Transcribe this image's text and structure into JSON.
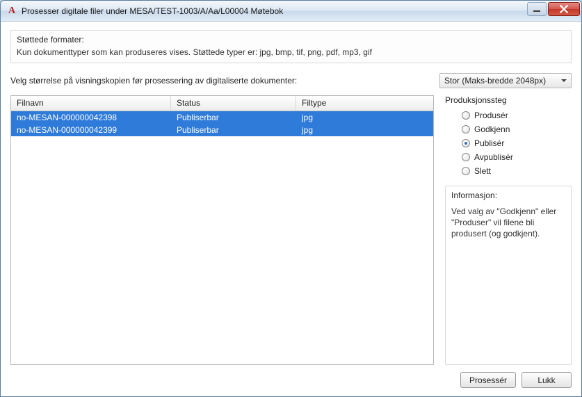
{
  "window": {
    "title": "Prosesser digitale filer under MESA/TEST-1003/A/Aa/L00004 Møtebok",
    "app_icon_glyph": "A"
  },
  "supported": {
    "title": "Støttede formater:",
    "body": "Kun dokumenttyper som kan produseres vises. Støttede typer er: jpg, bmp, tif, png, pdf, mp3, gif"
  },
  "size_row": {
    "label": "Velg størrelse på visningskopien før prosessering av digitaliserte dokumenter:",
    "selected": "Stor (Maks-bredde 2048px)"
  },
  "table": {
    "columns": {
      "filnavn": "Filnavn",
      "status": "Status",
      "filtype": "Filtype"
    },
    "rows": [
      {
        "filnavn": "no-MESAN-000000042398",
        "status": "Publiserbar",
        "filtype": "jpg",
        "selected": true
      },
      {
        "filnavn": "no-MESAN-000000042399",
        "status": "Publiserbar",
        "filtype": "jpg",
        "selected": true
      }
    ]
  },
  "steps": {
    "title": "Produksjonssteg",
    "options": [
      {
        "label": "Produsér",
        "checked": false
      },
      {
        "label": "Godkjenn",
        "checked": false
      },
      {
        "label": "Publisér",
        "checked": true
      },
      {
        "label": "Avpublisér",
        "checked": false
      },
      {
        "label": "Slett",
        "checked": false
      }
    ]
  },
  "information": {
    "title": "Informasjon:",
    "body": "Ved valg av \"Godkjenn\" eller \"Produser\" vil filene bli produsert (og godkjent)."
  },
  "footer": {
    "process": "Prosessér",
    "close": "Lukk"
  }
}
